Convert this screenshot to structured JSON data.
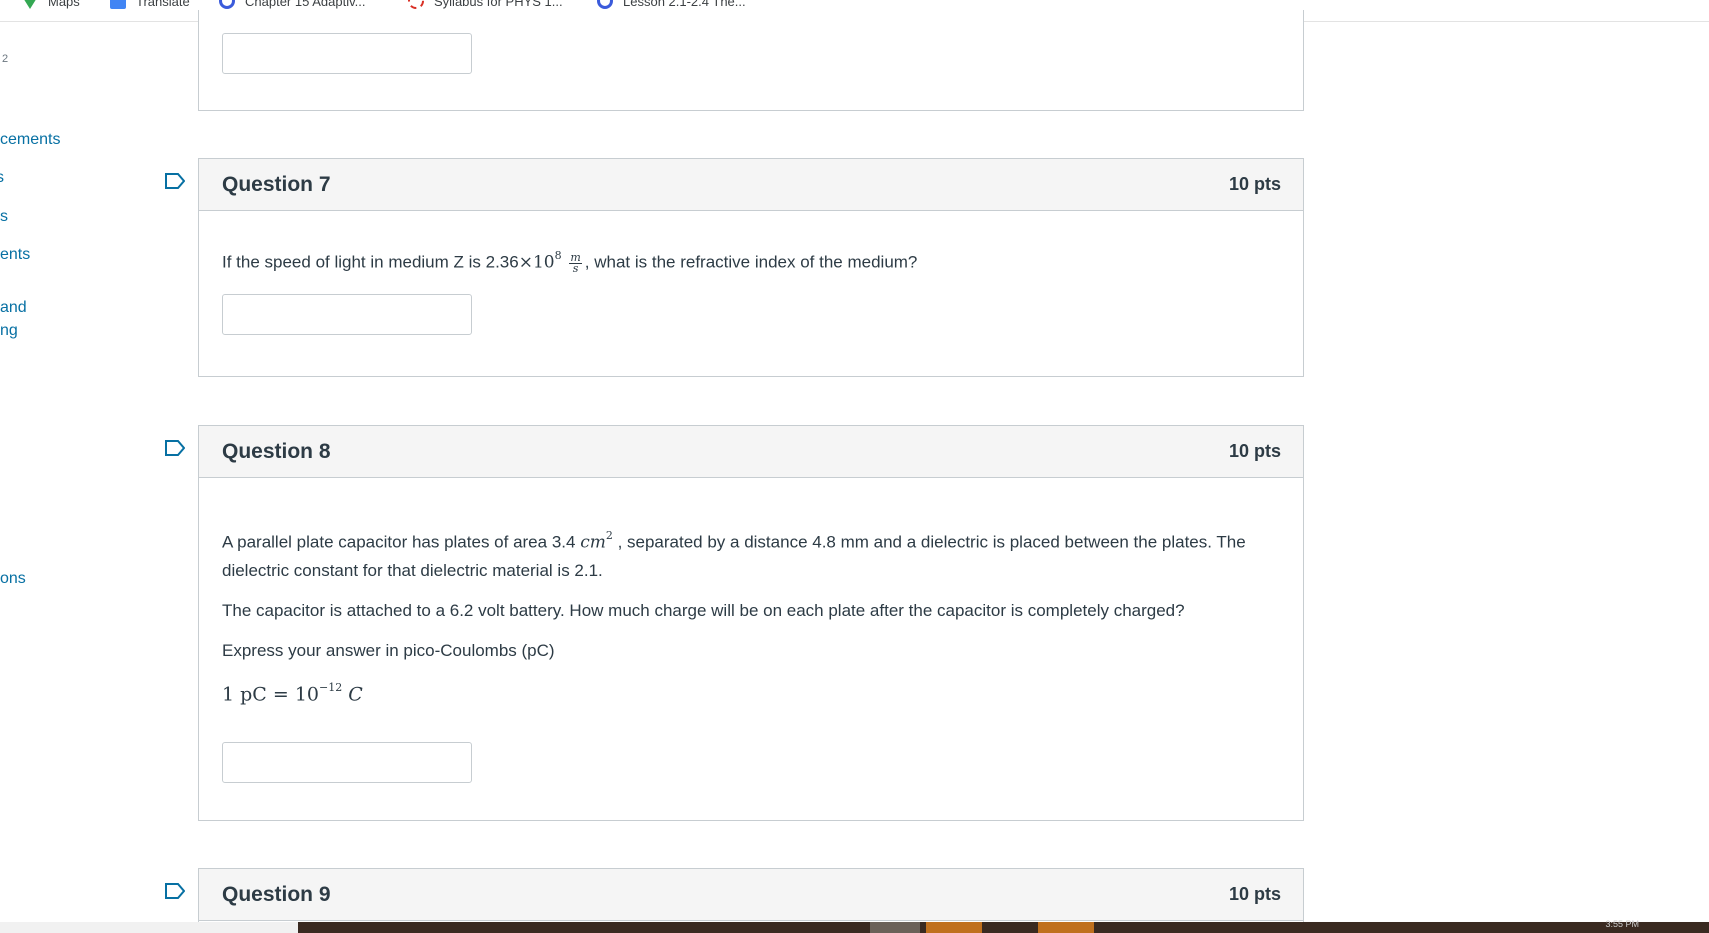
{
  "bookmarks": [
    {
      "label": "Maps",
      "icon": "maps-icon"
    },
    {
      "label": "Translate",
      "icon": "translate-icon"
    },
    {
      "label": "Chapter 15 Adaptiv...",
      "icon": "quiz-icon"
    },
    {
      "label": "Syllabus for PHYS 1...",
      "icon": "syllabus-icon"
    },
    {
      "label": "Lesson 2.1-2.4 The...",
      "icon": "quiz-icon"
    }
  ],
  "nav": {
    "small_label": "2",
    "items": [
      "cements",
      "s",
      "s",
      "ents",
      "and",
      "ng",
      "ons"
    ]
  },
  "questions": [
    {
      "title": "Question 7",
      "points": "10 pts",
      "text_before": "If the speed of light in medium Z is 2.36",
      "times": "×",
      "base": "10",
      "exponent": "8",
      "unit_num": "m",
      "unit_den": "s",
      "text_after": ", what is the refractive index of the medium?",
      "answer": ""
    },
    {
      "title": "Question 8",
      "points": "10 pts",
      "p1_before": "A parallel plate capacitor has plates of area 3.4",
      "p1_unit": "cm",
      "p1_exp": "2",
      "p1_after": " , separated by a distance 4.8 mm and a dielectric is placed between the plates. The dielectric constant for that dielectric material is 2.1.",
      "p2": "The capacitor is attached to a 6.2 volt battery. How much charge will be on each plate after the capacitor is completely charged?",
      "p3": "Express your answer in pico-Coulombs (pC)",
      "eq_lhs": "1 pC = 10",
      "eq_exp": "−12",
      "eq_rhs": " C",
      "answer": ""
    },
    {
      "title": "Question 9",
      "points": "10 pts"
    }
  ],
  "taskbar": {
    "clock": "3:55 PM"
  }
}
